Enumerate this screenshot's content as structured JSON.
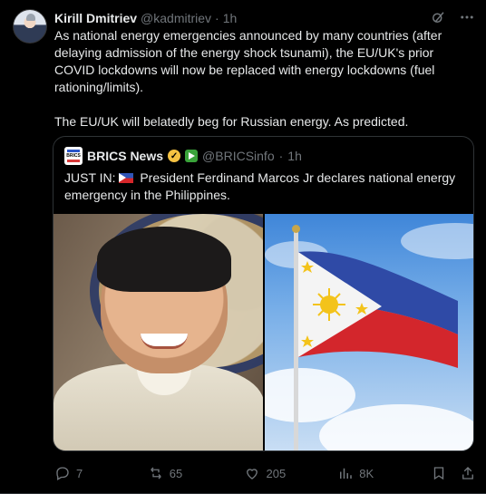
{
  "tweet": {
    "author_name": "Kirill Dmitriev",
    "author_handle": "@kadmitriev",
    "separator": "·",
    "time": "1h",
    "text_p1": "As national energy emergencies announced by many countries (after delaying admission of the energy shock tsunami), the EU/UK's prior COVID lockdowns will now be replaced with energy lockdowns (fuel rationing/limits).",
    "text_p2": "The EU/UK will belatedly beg for Russian energy. As predicted."
  },
  "quote": {
    "author_name": "BRICS News",
    "author_handle": "@BRICSinfo",
    "separator": "·",
    "time": "1h",
    "text_prefix": "JUST IN:",
    "text_body": "President Ferdinand Marcos Jr declares national energy emergency in the Philippines.",
    "logo_text": "BRICS"
  },
  "actions": {
    "replies": "7",
    "reposts": "65",
    "likes": "205",
    "views": "8K"
  },
  "icons": [
    "grok-icon",
    "more-icon",
    "reply-icon",
    "repost-icon",
    "like-icon",
    "views-icon",
    "bookmark-icon",
    "share-icon"
  ],
  "colors": {
    "background": "#000000",
    "text": "#e7e9ea",
    "muted": "#71767b",
    "border": "#2f3336"
  }
}
